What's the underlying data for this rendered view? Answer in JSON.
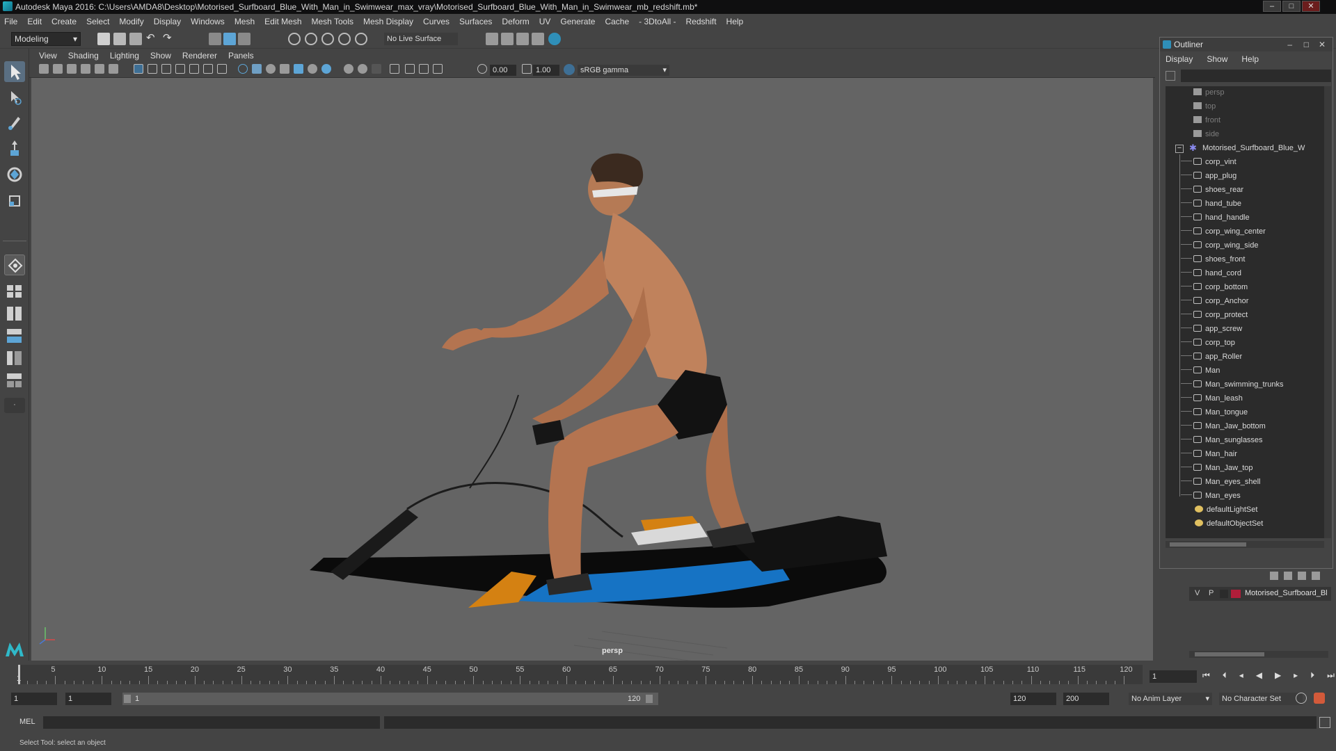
{
  "window": {
    "title": "Autodesk Maya 2016: C:\\Users\\AMDA8\\Desktop\\Motorised_Surfboard_Blue_With_Man_in_Swimwear_max_vray\\Motorised_Surfboard_Blue_With_Man_in_Swimwear_mb_redshift.mb*",
    "minimize": "‒",
    "maximize": "□",
    "close": "✕"
  },
  "menubar": {
    "items": [
      "File",
      "Edit",
      "Create",
      "Select",
      "Modify",
      "Display",
      "Windows",
      "Mesh",
      "Edit Mesh",
      "Mesh Tools",
      "Mesh Display",
      "Curves",
      "Surfaces",
      "Deform",
      "UV",
      "Generate",
      "Cache",
      "- 3DtoAll -",
      "Redshift",
      "Help"
    ]
  },
  "statusline": {
    "mode": "Modeling",
    "live_surface": "No Live Surface"
  },
  "viewport": {
    "menu": [
      "View",
      "Shading",
      "Lighting",
      "Show",
      "Renderer",
      "Panels"
    ],
    "exposure": "0.00",
    "gamma": "1.00",
    "color_space": "sRGB gamma",
    "camera_label": "persp",
    "background_color": "#646464"
  },
  "outliner": {
    "title": "Outliner",
    "menu": [
      "Display",
      "Show",
      "Help"
    ],
    "cameras": [
      "persp",
      "top",
      "front",
      "side"
    ],
    "root": "Motorised_Surfboard_Blue_W",
    "children": [
      "corp_vint",
      "app_plug",
      "shoes_rear",
      "hand_tube",
      "hand_handle",
      "corp_wing_center",
      "corp_wing_side",
      "shoes_front",
      "hand_cord",
      "corp_bottom",
      "corp_Anchor",
      "corp_protect",
      "app_screw",
      "corp_top",
      "app_Roller",
      "Man",
      "Man_swimming_trunks",
      "Man_leash",
      "Man_tongue",
      "Man_Jaw_bottom",
      "Man_sunglasses",
      "Man_hair",
      "Man_Jaw_top",
      "Man_eyes_shell",
      "Man_eyes"
    ],
    "sets": [
      "defaultLightSet",
      "defaultObjectSet"
    ]
  },
  "layer_editor": {
    "visible_flag": "V",
    "playback_flag": "P",
    "layer_name": "Motorised_Surfboard_Bl",
    "layer_color": "#b01e3a"
  },
  "timeline": {
    "ticks": [
      "5",
      "10",
      "15",
      "20",
      "25",
      "30",
      "35",
      "40",
      "45",
      "50",
      "55",
      "60",
      "65",
      "70",
      "75",
      "80",
      "85",
      "90",
      "95",
      "100",
      "105",
      "110",
      "115",
      "120"
    ],
    "start_tick": "1",
    "current_frame": "1"
  },
  "range": {
    "start": "1",
    "playback_start": "1",
    "slider_start": "1",
    "slider_end": "120",
    "playback_end": "120",
    "end": "200",
    "anim_layer": "No Anim Layer",
    "character_set": "No Character Set"
  },
  "command_line": {
    "label": "MEL"
  },
  "help_line": "Select Tool: select an object"
}
